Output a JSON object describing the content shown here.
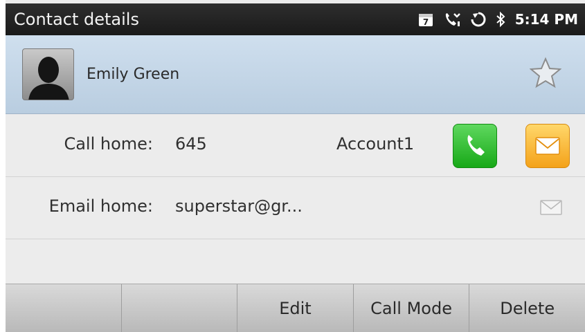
{
  "status_bar": {
    "title": "Contact details",
    "calendar_day": "7",
    "time": "5:14 PM",
    "icons": [
      "calendar-icon",
      "missed-call-icon",
      "sync-icon",
      "bluetooth-icon"
    ]
  },
  "contact": {
    "name": "Emily Green",
    "favorite_icon": "star-outline-icon"
  },
  "rows": {
    "call": {
      "label": "Call home:",
      "value": "645",
      "account": "Account1"
    },
    "email": {
      "label": "Email home:",
      "value": "superstar@gr..."
    }
  },
  "softkeys": [
    "",
    "",
    "Edit",
    "Call Mode",
    "Delete"
  ],
  "colors": {
    "status_bar_bg": "#1f1f1f",
    "header_bg": "#c4d6e8",
    "call_green": "#22b022",
    "message_orange": "#f7b02a",
    "page_bg": "#ececec"
  }
}
